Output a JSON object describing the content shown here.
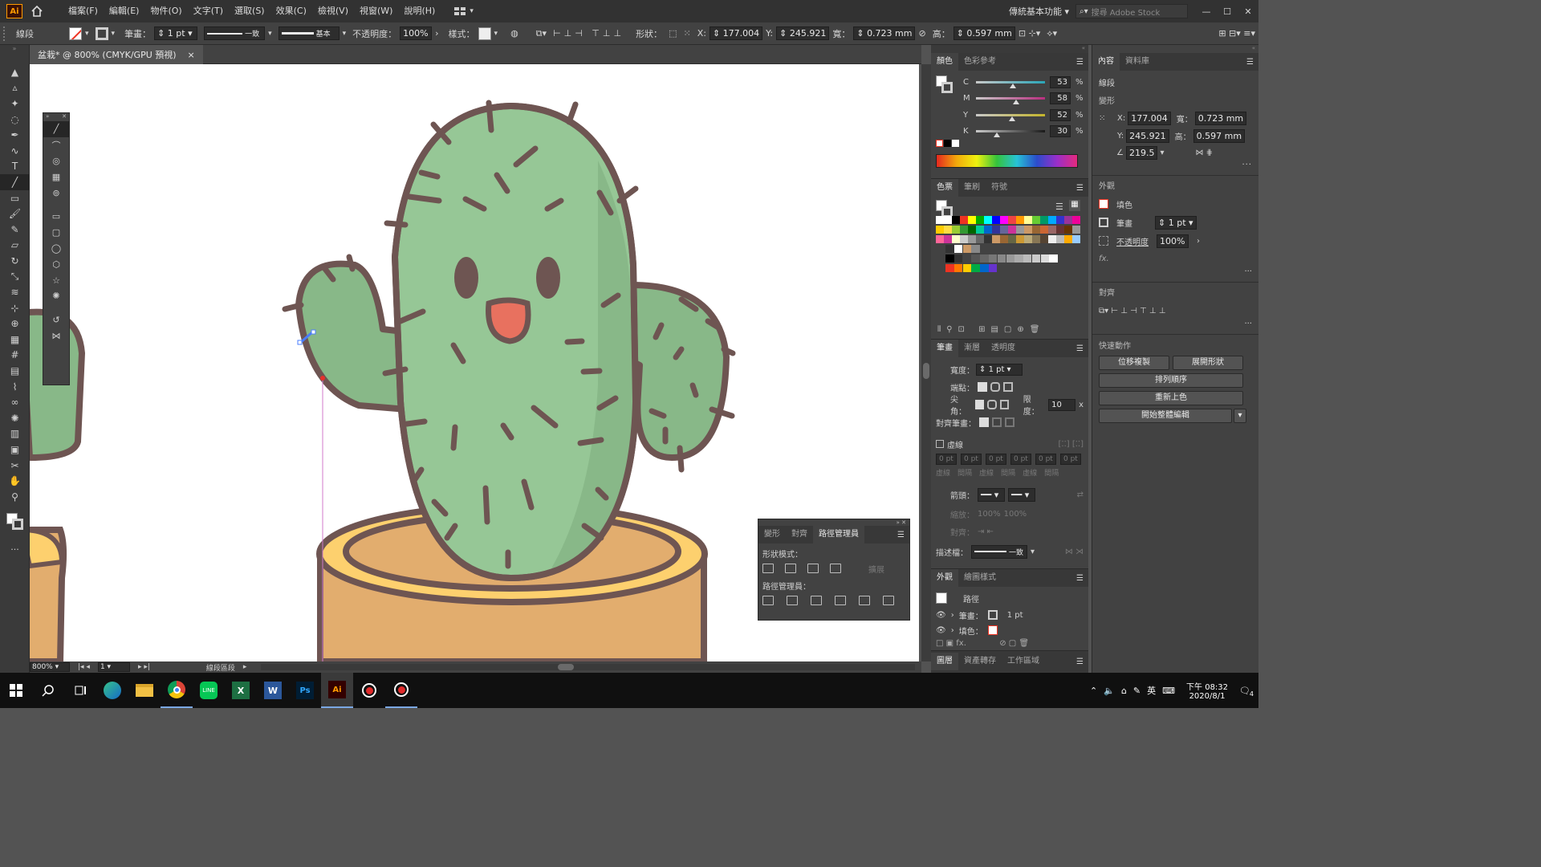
{
  "app": {
    "logo": "Ai",
    "workspace": "傳統基本功能",
    "search_placeholder": "搜尋 Adobe Stock"
  },
  "menu": [
    "檔案(F)",
    "編輯(E)",
    "物件(O)",
    "文字(T)",
    "選取(S)",
    "效果(C)",
    "檢視(V)",
    "視窗(W)",
    "說明(H)"
  ],
  "control": {
    "object_type": "線段",
    "stroke_label": "筆畫：",
    "stroke_weight": "1 pt",
    "stroke_style": "一致",
    "brush": "基本",
    "opacity_label": "不透明度：",
    "opacity": "100%",
    "style_label": "樣式：",
    "shape_label": "形狀：",
    "x_label": "X:",
    "x": "177.004",
    "y_label": "Y:",
    "y": "245.921",
    "w_label": "寬：",
    "w": "0.723 mm",
    "h_label": "高：",
    "h": "0.597 mm"
  },
  "document": {
    "tab": "盆栽* @ 800% (CMYK/GPU 預視)",
    "close": "×"
  },
  "status": {
    "zoom": "800%",
    "artboard": "1",
    "tool": "線段區段"
  },
  "color_panel": {
    "tabs": [
      "顏色",
      "色彩參考"
    ],
    "channels": [
      {
        "k": "C",
        "v": "53",
        "pct": "%",
        "fill": 0.53
      },
      {
        "k": "M",
        "v": "58",
        "pct": "%",
        "fill": 0.58
      },
      {
        "k": "Y",
        "v": "52",
        "pct": "%",
        "fill": 0.52
      },
      {
        "k": "K",
        "v": "30",
        "pct": "%",
        "fill": 0.3
      }
    ]
  },
  "swatch_panel": {
    "tabs": [
      "色票",
      "筆刷",
      "符號"
    ]
  },
  "stroke_panel": {
    "tabs": [
      "筆畫",
      "漸層",
      "透明度"
    ],
    "weight_label": "寬度：",
    "weight": "1 pt",
    "cap_label": "端點：",
    "corner_label": "尖角：",
    "limit_label": "限度：",
    "limit": "10",
    "limit_unit": "x",
    "align_label": "對齊筆畫：",
    "dashed": "虛線",
    "dash_values": [
      "0 pt",
      "0 pt",
      "0 pt",
      "0 pt",
      "0 pt",
      "0 pt"
    ],
    "dash_labels": [
      "虛線",
      "間隔",
      "虛線",
      "間隔",
      "虛線",
      "間隔"
    ],
    "arrow_label": "箭頭：",
    "scale_label": "縮放：",
    "scale1": "100%",
    "scale2": "100%",
    "align2_label": "對齊：",
    "profile_label": "描述檔：",
    "profile": "一致"
  },
  "appearance_panel": {
    "tabs": [
      "外觀",
      "繪圖樣式"
    ],
    "item": "路徑",
    "stroke_label": "筆畫：",
    "stroke": "1 pt",
    "fill_label": "填色："
  },
  "bottom_tabs": [
    "圖層",
    "資產轉存",
    "工作區域"
  ],
  "properties": {
    "tabs": [
      "內容",
      "資料庫"
    ],
    "object": "線段",
    "transform": "變形",
    "x_label": "X:",
    "x": "177.004",
    "y_label": "Y:",
    "y": "245.921",
    "w_label": "寬：",
    "w": "0.723 mm",
    "h_label": "高：",
    "h": "0.597 mm",
    "angle": "219.5",
    "appearance": "外觀",
    "fill": "填色",
    "stroke": "筆畫",
    "stroke_val": "1 pt",
    "opacity": "不透明度",
    "opacity_val": "100%",
    "fx": "fx.",
    "align": "對齊",
    "quick": "快速動作",
    "btn_offset": "位移複製",
    "btn_expand": "展開形狀",
    "btn_arrange": "排列順序",
    "btn_recolor": "重新上色",
    "btn_isolate": "開始整體編輯"
  },
  "pathfinder": {
    "tabs": [
      "變形",
      "對齊",
      "路徑管理員"
    ],
    "shape_modes": "形狀模式：",
    "expand": "擴展",
    "pathfinders": "路徑管理員："
  },
  "taskbar": {
    "time": "下午 08:32",
    "date": "2020/8/1",
    "ime": "英",
    "notif": "4"
  },
  "colors": {
    "cactus": "#96c796",
    "cactus_dark": "#88b888",
    "outline": "#6e5552",
    "pot": "#e2ad6e",
    "pot_rim": "#fdd06e",
    "mouth": "#e8715f"
  }
}
